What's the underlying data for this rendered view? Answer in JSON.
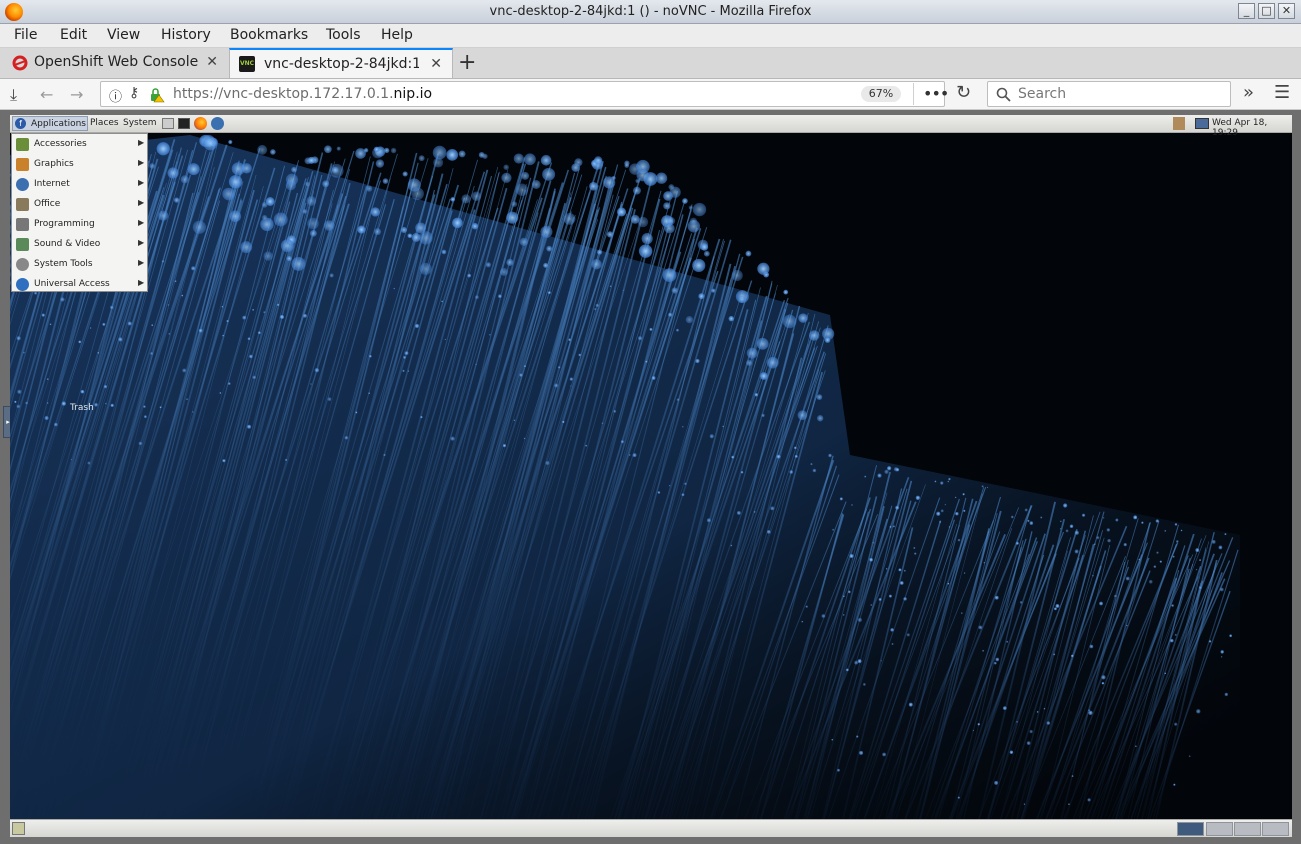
{
  "window": {
    "title": "vnc-desktop-2-84jkd:1 () - noVNC - Mozilla Firefox"
  },
  "menubar": {
    "items": [
      "File",
      "Edit",
      "View",
      "History",
      "Bookmarks",
      "Tools",
      "Help"
    ]
  },
  "tabs": [
    {
      "label": "OpenShift Web Console",
      "active": false
    },
    {
      "label": "vnc-desktop-2-84jkd:1 ()",
      "active": true
    }
  ],
  "navbar": {
    "url_prefix": "https://vnc-desktop.172.17.0.1.",
    "url_domain": "nip.io",
    "zoom": "67%",
    "search_placeholder": "Search"
  },
  "remote_desktop": {
    "panel": {
      "menus": [
        "Applications",
        "Places",
        "System"
      ],
      "clock": "Wed Apr 18, 19:29"
    },
    "app_menu": [
      {
        "label": "Accessories",
        "icon": "accessories-icon",
        "color": "#6b8e3a"
      },
      {
        "label": "Graphics",
        "icon": "graphics-icon",
        "color": "#c9822b"
      },
      {
        "label": "Internet",
        "icon": "internet-icon",
        "color": "#3b6fb0"
      },
      {
        "label": "Office",
        "icon": "office-icon",
        "color": "#8a7a5c"
      },
      {
        "label": "Programming",
        "icon": "programming-icon",
        "color": "#777777"
      },
      {
        "label": "Sound & Video",
        "icon": "sound-video-icon",
        "color": "#5a8a5a"
      },
      {
        "label": "System Tools",
        "icon": "system-tools-icon",
        "color": "#888888"
      },
      {
        "label": "Universal Access",
        "icon": "universal-access-icon",
        "color": "#2f6fbf"
      }
    ],
    "desktop_icons": [
      {
        "label": "Trash"
      }
    ]
  },
  "colors": {
    "accent": "#0a84ff",
    "desktop_blue": "#3d7fd8"
  }
}
